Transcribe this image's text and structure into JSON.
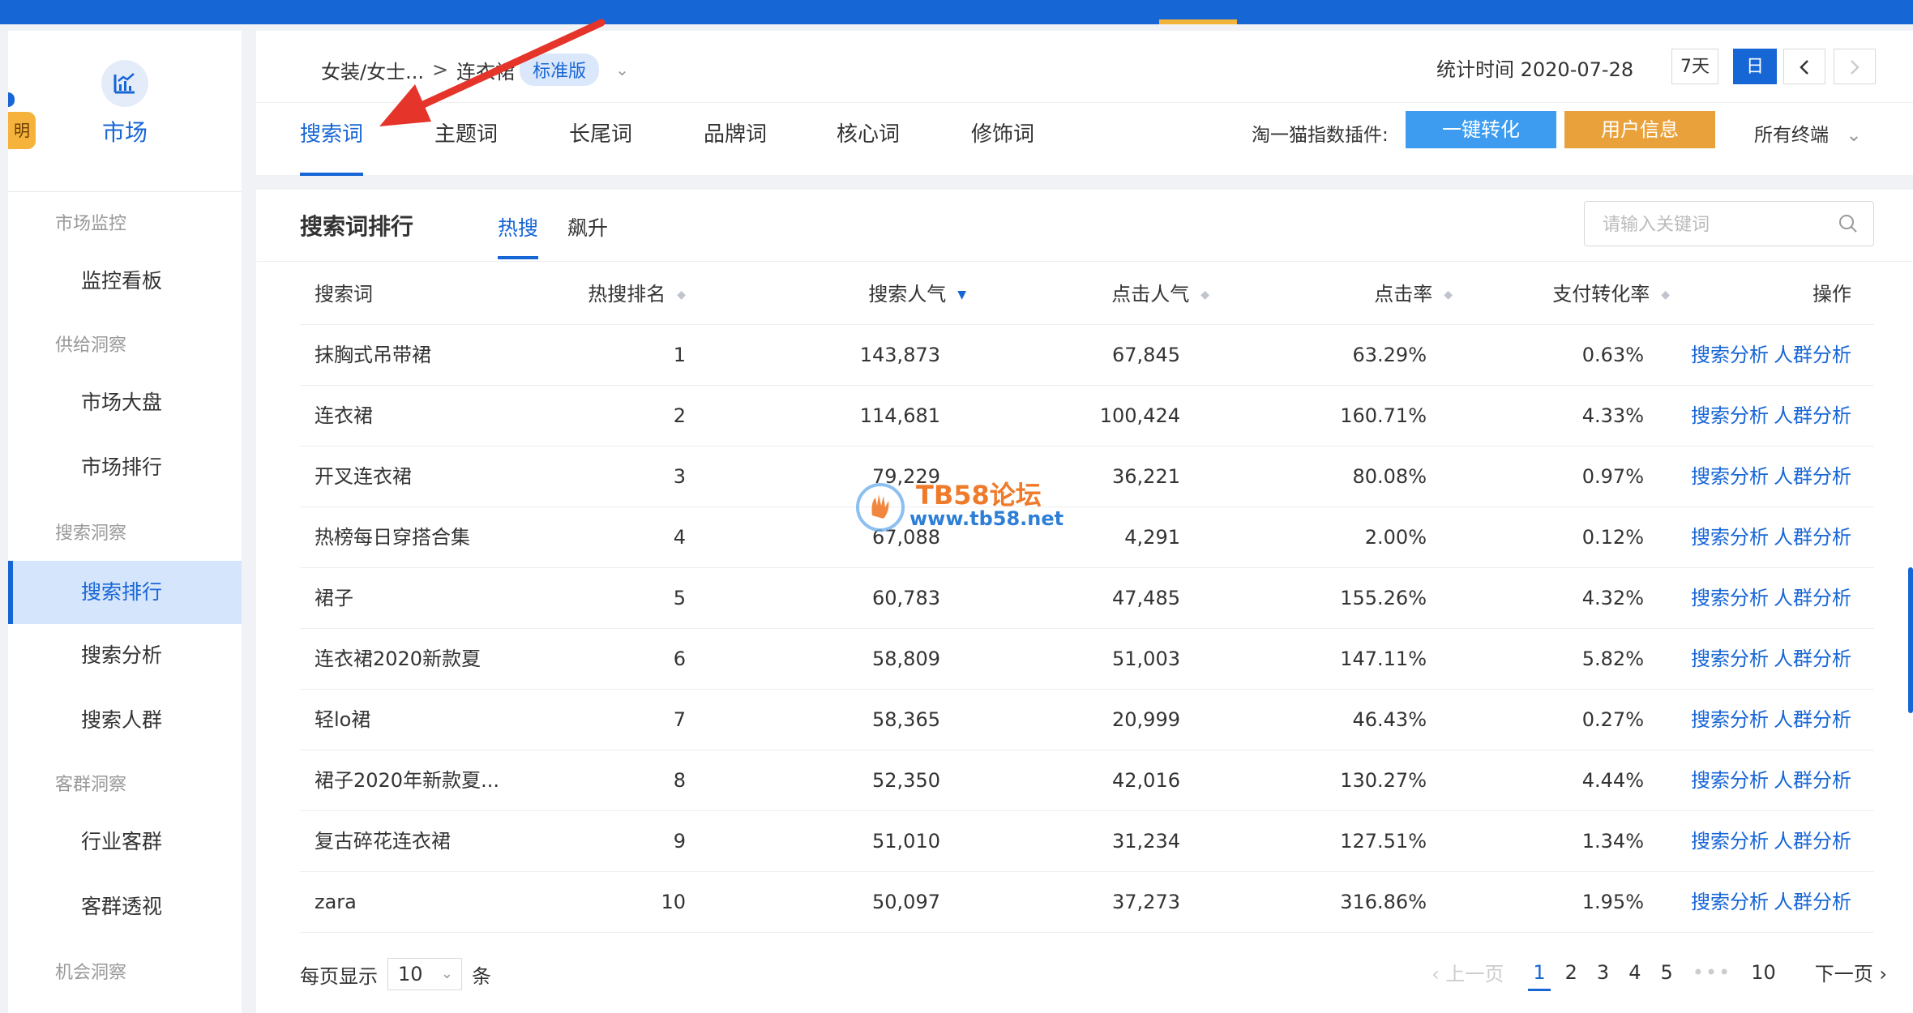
{
  "sidebar": {
    "brand": {
      "label": "市场",
      "icon": "market-chart-icon"
    },
    "edge_badge": "明",
    "sections": [
      {
        "title": "市场监控",
        "items": [
          "监控看板"
        ]
      },
      {
        "title": "供给洞察",
        "items": [
          "市场大盘",
          "市场排行"
        ]
      },
      {
        "title": "搜索洞察",
        "items": [
          "搜索排行",
          "搜索分析",
          "搜索人群"
        ]
      },
      {
        "title": "客群洞察",
        "items": [
          "行业客群",
          "客群透视"
        ]
      },
      {
        "title": "机会洞察",
        "items": []
      }
    ],
    "active_item": "搜索排行"
  },
  "header": {
    "breadcrumb": {
      "category": "女装/女士...",
      "separator": ">",
      "current": "连衣裙",
      "version_badge": "标准版"
    },
    "stat_time_label": "统计时间 2020-07-28",
    "range_buttons": [
      "7天",
      "日"
    ],
    "active_range": "日",
    "tabs": [
      "搜索词",
      "主题词",
      "长尾词",
      "品牌词",
      "核心词",
      "修饰词"
    ],
    "active_tab": "搜索词",
    "plugin_label": "淘一猫指数插件:",
    "convert_button": "一键转化",
    "user_info_button": "用户信息",
    "terminal_select": "所有终端",
    "colors": {
      "primary": "#1766d6",
      "convert": "#3d9cf0",
      "user_info": "#e9a23b"
    }
  },
  "main": {
    "title": "搜索词排行",
    "subtabs": [
      "热搜",
      "飙升"
    ],
    "active_subtab": "热搜",
    "search_placeholder": "请输入关键词",
    "columns": [
      "搜索词",
      "热搜排名",
      "搜索人气",
      "点击人气",
      "点击率",
      "支付转化率",
      "操作"
    ],
    "sorted_column": "搜索人气",
    "action_links": [
      "搜索分析",
      "人群分析"
    ],
    "rows": [
      {
        "word": "抹胸式吊带裙",
        "rank": "1",
        "search": "143,873",
        "click": "67,845",
        "ctr": "63.29%",
        "cvr": "0.63%"
      },
      {
        "word": "连衣裙",
        "rank": "2",
        "search": "114,681",
        "click": "100,424",
        "ctr": "160.71%",
        "cvr": "4.33%"
      },
      {
        "word": "开叉连衣裙",
        "rank": "3",
        "search": "79,229",
        "click": "36,221",
        "ctr": "80.08%",
        "cvr": "0.97%"
      },
      {
        "word": "热榜每日穿搭合集",
        "rank": "4",
        "search": "67,088",
        "click": "4,291",
        "ctr": "2.00%",
        "cvr": "0.12%"
      },
      {
        "word": "裙子",
        "rank": "5",
        "search": "60,783",
        "click": "47,485",
        "ctr": "155.26%",
        "cvr": "4.32%"
      },
      {
        "word": "连衣裙2020新款夏",
        "rank": "6",
        "search": "58,809",
        "click": "51,003",
        "ctr": "147.11%",
        "cvr": "5.82%"
      },
      {
        "word": "轻lo裙",
        "rank": "7",
        "search": "58,365",
        "click": "20,999",
        "ctr": "46.43%",
        "cvr": "0.27%"
      },
      {
        "word": "裙子2020年新款夏...",
        "rank": "8",
        "search": "52,350",
        "click": "42,016",
        "ctr": "130.27%",
        "cvr": "4.44%"
      },
      {
        "word": "复古碎花连衣裙",
        "rank": "9",
        "search": "51,010",
        "click": "31,234",
        "ctr": "127.51%",
        "cvr": "1.34%"
      },
      {
        "word": "zara",
        "rank": "10",
        "search": "50,097",
        "click": "37,273",
        "ctr": "316.86%",
        "cvr": "1.95%"
      }
    ]
  },
  "pagination": {
    "per_page_label": "每页显示",
    "per_page_value": "10",
    "per_page_unit": "条",
    "prev": "上一页",
    "pages": [
      "1",
      "2",
      "3",
      "4",
      "5"
    ],
    "ellipsis": "•••",
    "last_page": "10",
    "current_page": "1",
    "next": "下一页"
  },
  "watermark": {
    "brand": "TB58论坛",
    "url": "www.tb58.net"
  }
}
